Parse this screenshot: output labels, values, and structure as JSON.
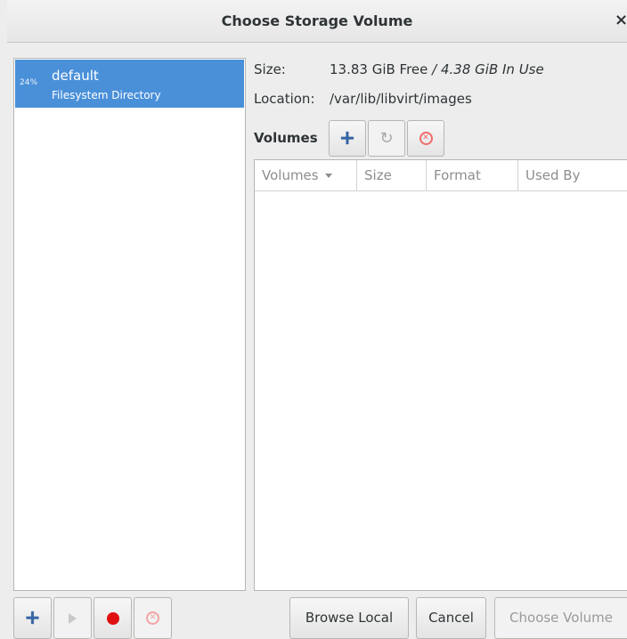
{
  "dialog": {
    "title": "Choose Storage Volume",
    "close_glyph": "×"
  },
  "pools": [
    {
      "usage": "24%",
      "name": "default",
      "type": "Filesystem Directory",
      "selected": true
    }
  ],
  "pool_info": {
    "size_label": "Size:",
    "size_free": "13.83 GiB Free",
    "size_sep": " / ",
    "size_in_use": "4.38 GiB In Use",
    "location_label": "Location:",
    "location_value": "/var/lib/libvirt/images"
  },
  "volumes": {
    "heading": "Volumes",
    "columns": [
      "Volumes",
      "Size",
      "Format",
      "Used By"
    ],
    "rows": []
  },
  "pool_actions": [
    "plus-icon",
    "play-icon",
    "record-icon",
    "delete-icon"
  ],
  "volume_actions": [
    "plus-icon",
    "refresh-icon",
    "delete-icon"
  ],
  "buttons": {
    "browse_local": "Browse Local",
    "cancel": "Cancel",
    "choose_volume": "Choose Volume"
  },
  "colors": {
    "selection": "#4a90d9",
    "add_icon": "#3465a4",
    "delete_icon": "#ef6a6a",
    "record_icon": "#e01010"
  }
}
